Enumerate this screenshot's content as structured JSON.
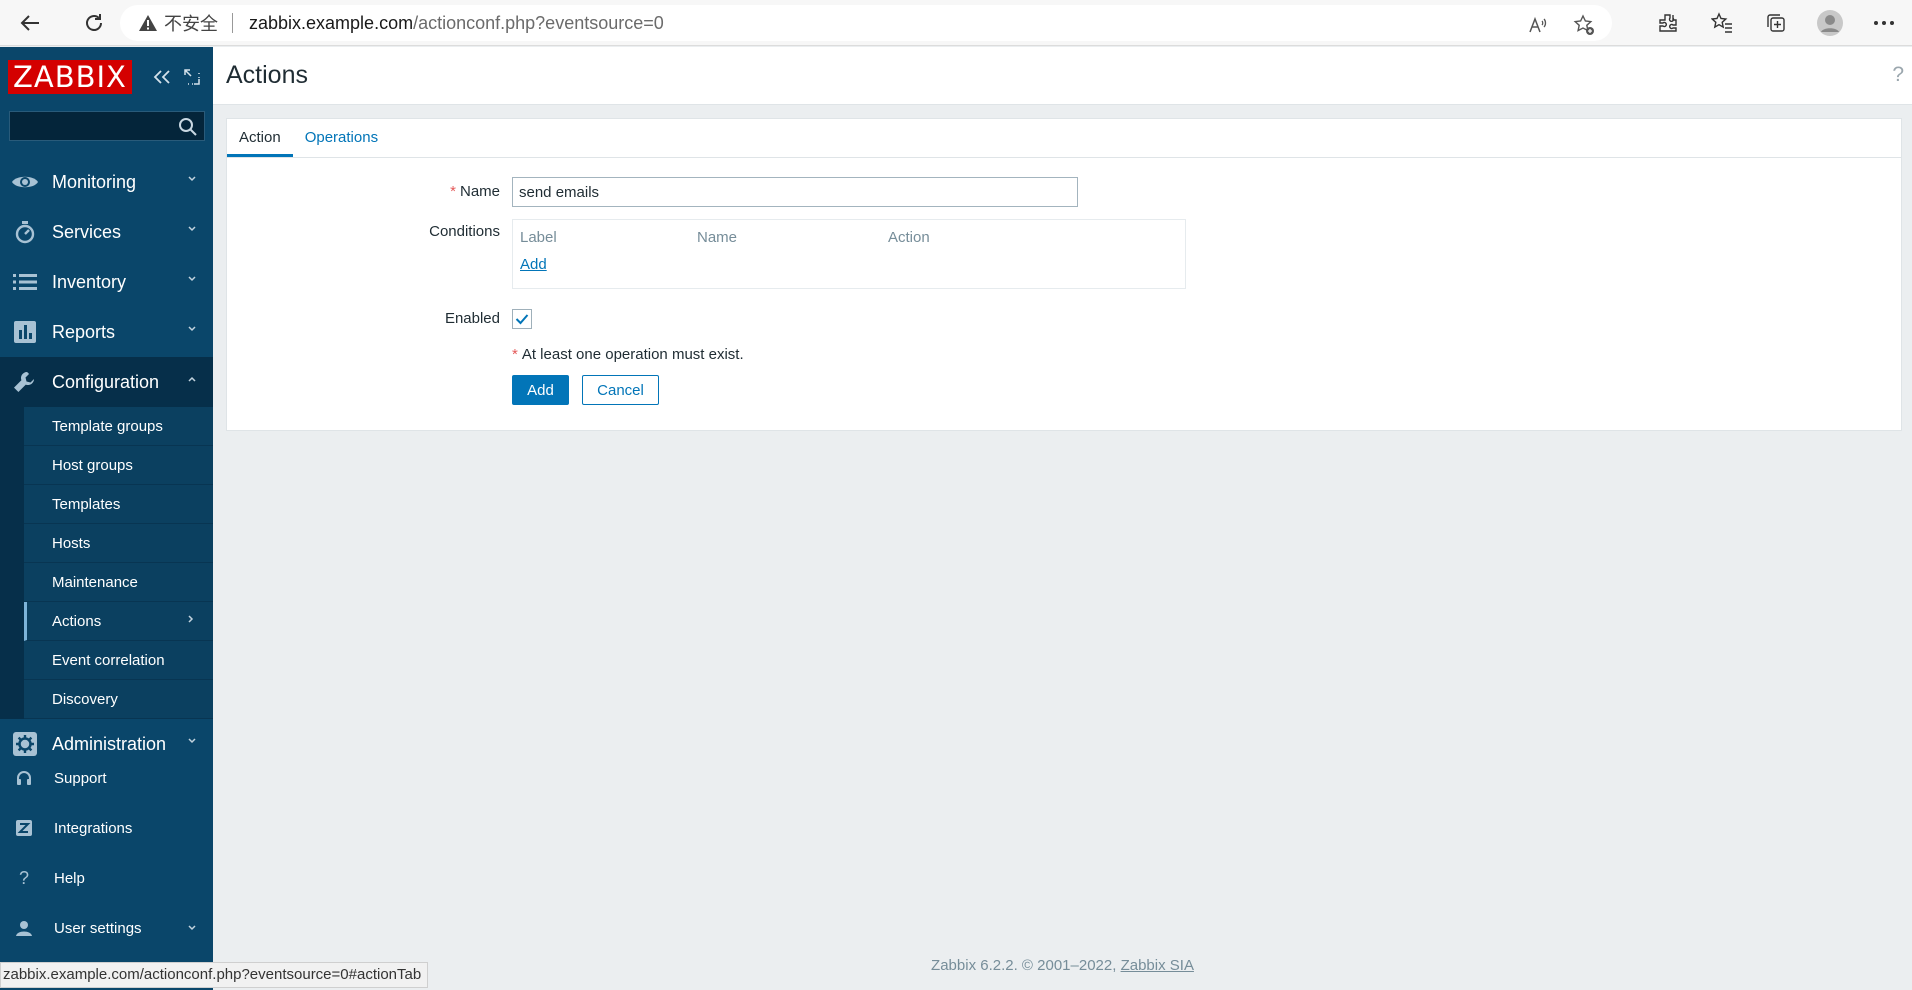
{
  "browser": {
    "insecure_label": "不安全",
    "url_host": "zabbix.example.com",
    "url_path": "/actionconf.php?eventsource=0",
    "status_url": "zabbix.example.com/actionconf.php?eventsource=0#actionTab"
  },
  "sidebar": {
    "logo": "ZABBIX",
    "search": {
      "value": "",
      "placeholder": ""
    },
    "menu": [
      {
        "label": "Monitoring",
        "icon": "eye-icon"
      },
      {
        "label": "Services",
        "icon": "stopwatch-icon"
      },
      {
        "label": "Inventory",
        "icon": "list-icon"
      },
      {
        "label": "Reports",
        "icon": "bar-chart-icon"
      },
      {
        "label": "Configuration",
        "icon": "wrench-icon"
      }
    ],
    "config_items": [
      "Template groups",
      "Host groups",
      "Templates",
      "Hosts",
      "Maintenance",
      "Actions",
      "Event correlation",
      "Discovery"
    ],
    "administration": "Administration",
    "bottom": [
      {
        "label": "Support",
        "icon": "headset-icon"
      },
      {
        "label": "Integrations",
        "icon": "z-logo-icon"
      },
      {
        "label": "Help",
        "icon": "question-icon"
      },
      {
        "label": "User settings",
        "icon": "user-icon"
      }
    ]
  },
  "main": {
    "title": "Actions",
    "help": "?",
    "tabs": [
      "Action",
      "Operations"
    ],
    "form": {
      "name_label": "Name",
      "name_value": "send emails",
      "conditions_label": "Conditions",
      "conditions_headers": [
        "Label",
        "Name",
        "Action"
      ],
      "conditions_add": "Add",
      "enabled_label": "Enabled",
      "enabled": true,
      "required_mark": "*",
      "note": "At least one operation must exist.",
      "add_button": "Add",
      "cancel_button": "Cancel"
    },
    "footer_text": "Zabbix 6.2.2. © 2001–2022,",
    "footer_link": "Zabbix SIA"
  },
  "colors": {
    "sidebar_bg": "#0a466a",
    "accent": "#0275b8",
    "logo_red": "#d40000",
    "required_red": "#e45959"
  }
}
